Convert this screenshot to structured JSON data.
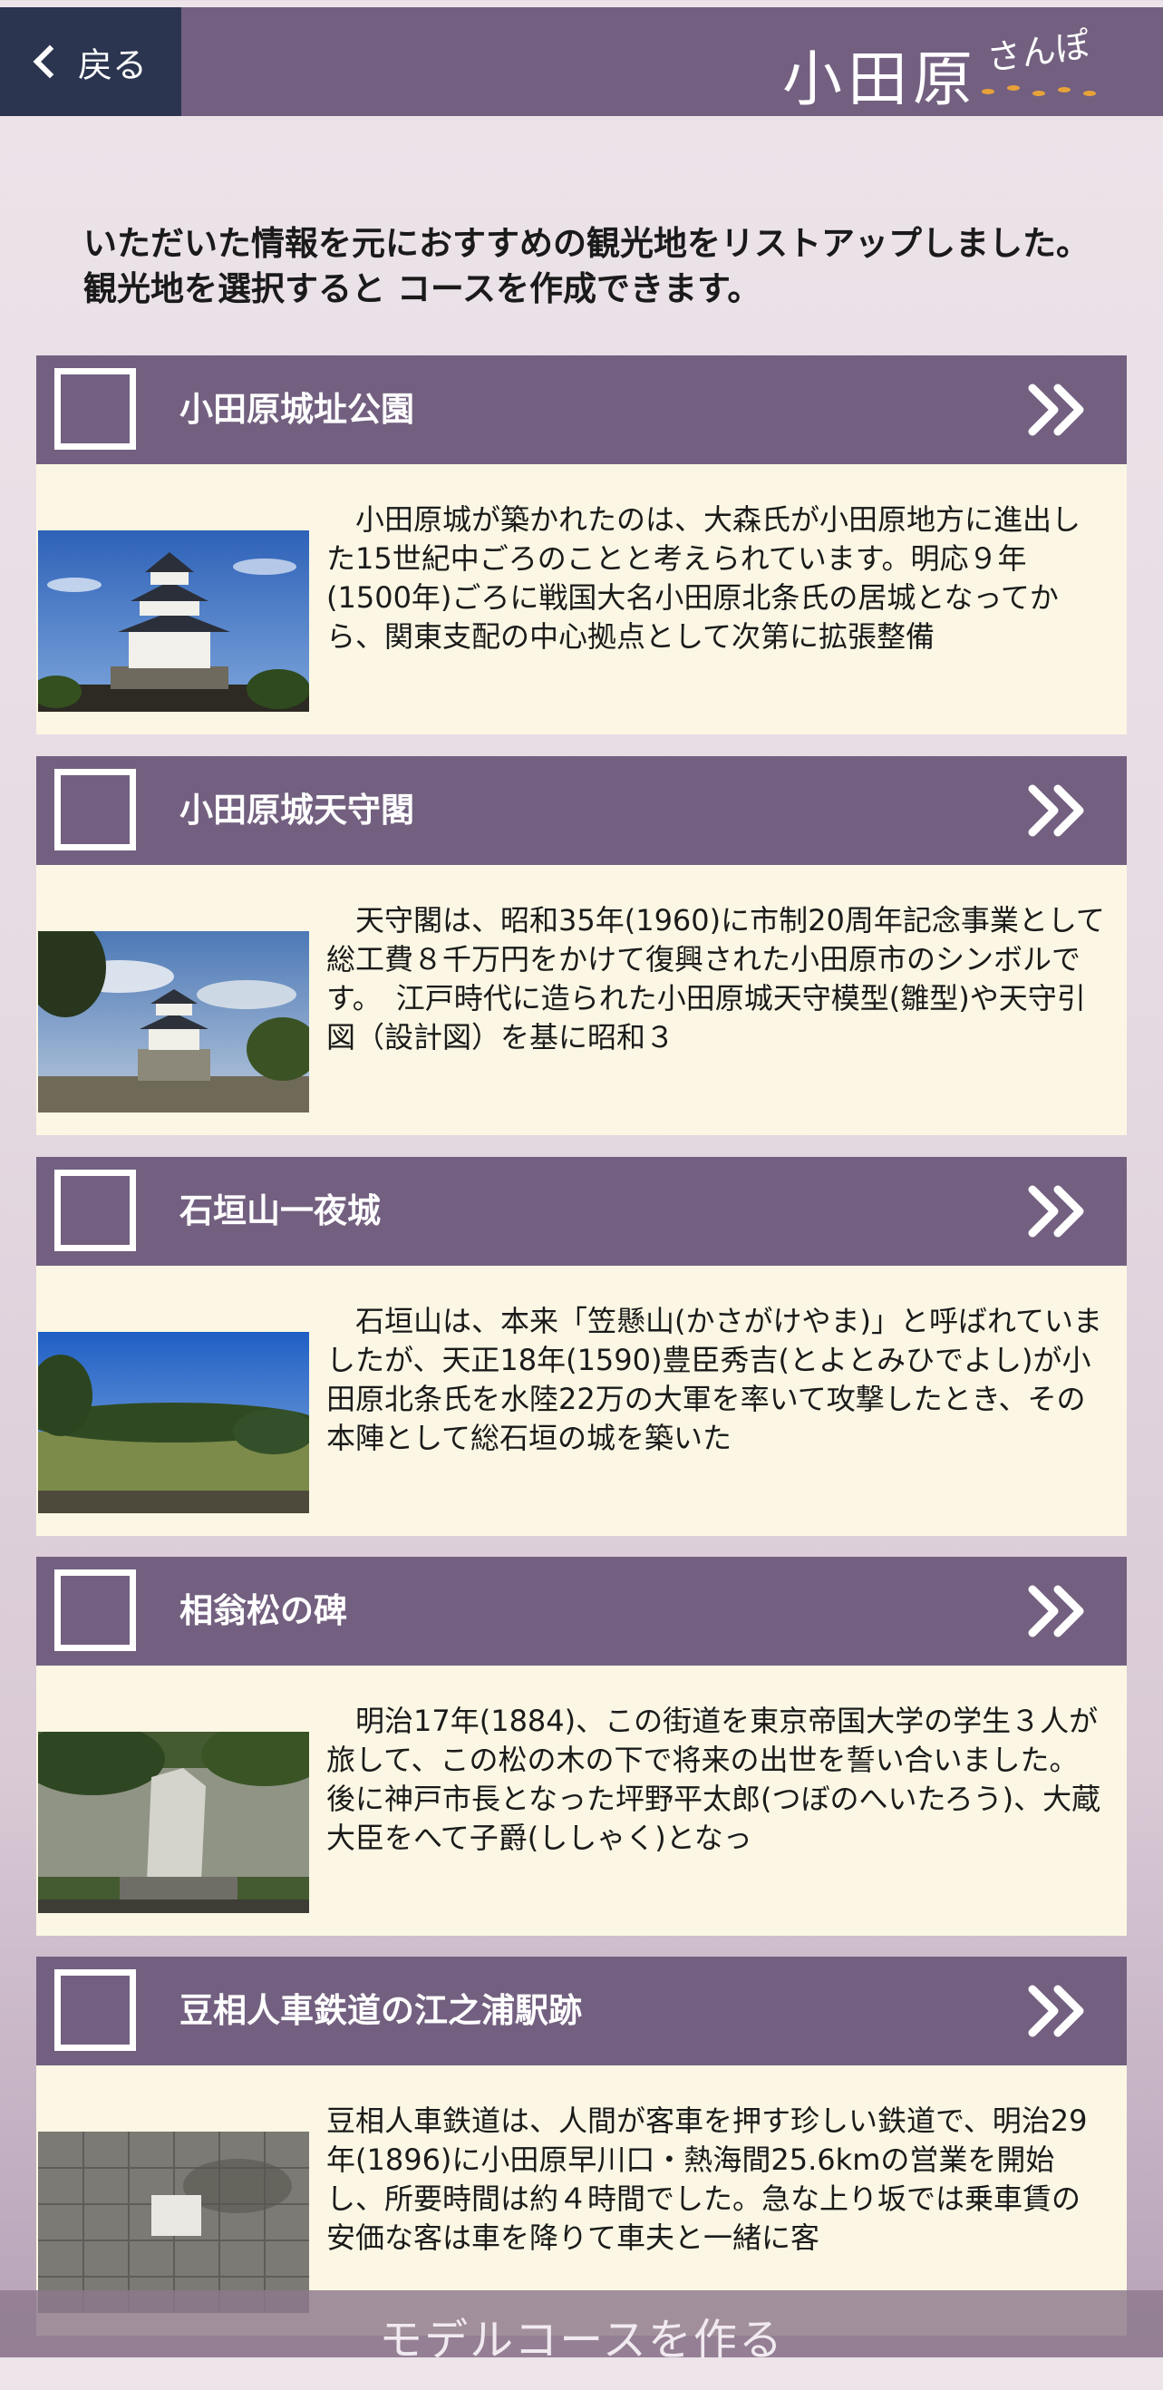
{
  "header": {
    "back_label": "戻る",
    "logo_text": "小田原",
    "logo_sub": "さんぽ"
  },
  "intro_text": "いただいた情報を元におすすめの観光地をリストアップしました。観光地を選択すると コースを作成できます。",
  "spots": [
    {
      "title": "小田原城址公園",
      "description": "　小田原城が築かれたのは、大森氏が小田原地方に進出した15世紀中ごろのことと考えられています。明応９年(1500年)ごろに戦国大名小田原北条氏の居城となってから、関東支配の中心拠点として次第に拡張整備"
    },
    {
      "title": "小田原城天守閣",
      "description": "　天守閣は、昭和35年(1960)に市制20周年記念事業として総工費８千万円をかけて復興された小田原市のシンボルです。　江戸時代に造られた小田原城天守模型(雛型)や天守引図（設計図）を基に昭和３"
    },
    {
      "title": "石垣山一夜城",
      "description": "　石垣山は、本来「笠懸山(かさがけやま)」と呼ばれていましたが、天正18年(1590)豊臣秀吉(とよとみひでよし)が小田原北条氏を水陸22万の大軍を率いて攻撃したとき、その本陣として総石垣の城を築いた"
    },
    {
      "title": "相翁松の碑",
      "description": "　明治17年(1884)、この街道を東京帝国大学の学生３人が旅して、この松の木の下で将来の出世を誓い合いました。後に神戸市長となった坪野平太郎(つぼのへいたろう)、大蔵大臣をへて子爵(ししゃく)となっ"
    },
    {
      "title": "豆相人車鉄道の江之浦駅跡",
      "description": "豆相人車鉄道は、人間が客車を押す珍しい鉄道で、明治29年(1896)に小田原早川口・熱海間25.6kmの営業を開始し、所要時間は約４時間でした。急な上り坂では乗車賃の安価な客は車を降りて車夫と一緒に客"
    }
  ],
  "bottom_button": "モデルコースを作る",
  "colors": {
    "header": "#736080",
    "back_button": "#2b3550",
    "card_body": "#fbf7e4",
    "logo_accent": "#e8a23a"
  }
}
